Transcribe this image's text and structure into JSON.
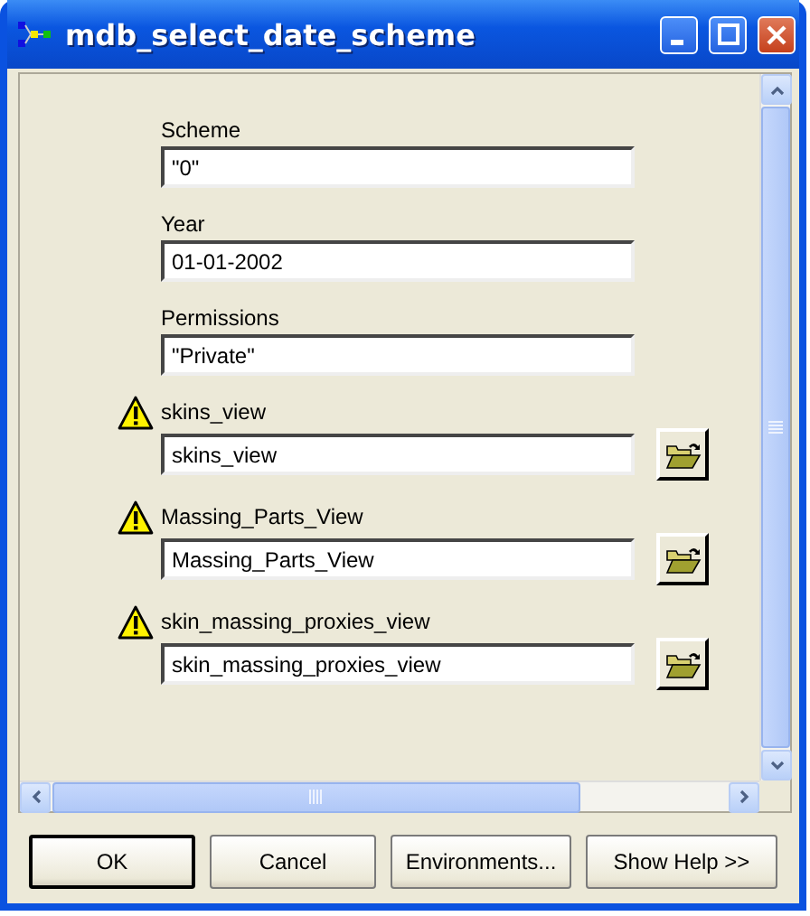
{
  "window": {
    "title": "mdb_select_date_scheme"
  },
  "parameters": [
    {
      "label": "Scheme",
      "value": "\"0\"",
      "kind": "plain",
      "warning": false
    },
    {
      "label": "Year",
      "value": "01-01-2002",
      "kind": "plain",
      "warning": false
    },
    {
      "label": "Permissions",
      "value": "\"Private\"",
      "kind": "plain",
      "warning": false
    },
    {
      "label": "skins_view",
      "value": "skins_view",
      "kind": "path",
      "warning": true
    },
    {
      "label": "Massing_Parts_View",
      "value": "Massing_Parts_View",
      "kind": "path",
      "warning": true
    },
    {
      "label": "skin_massing_proxies_view",
      "value": "skin_massing_proxies_view",
      "kind": "path",
      "warning": true
    }
  ],
  "buttons": [
    {
      "label": "OK",
      "default": true
    },
    {
      "label": "Cancel",
      "default": false
    },
    {
      "label": "Environments...",
      "default": false
    },
    {
      "label": "Show Help >>",
      "default": false
    }
  ]
}
